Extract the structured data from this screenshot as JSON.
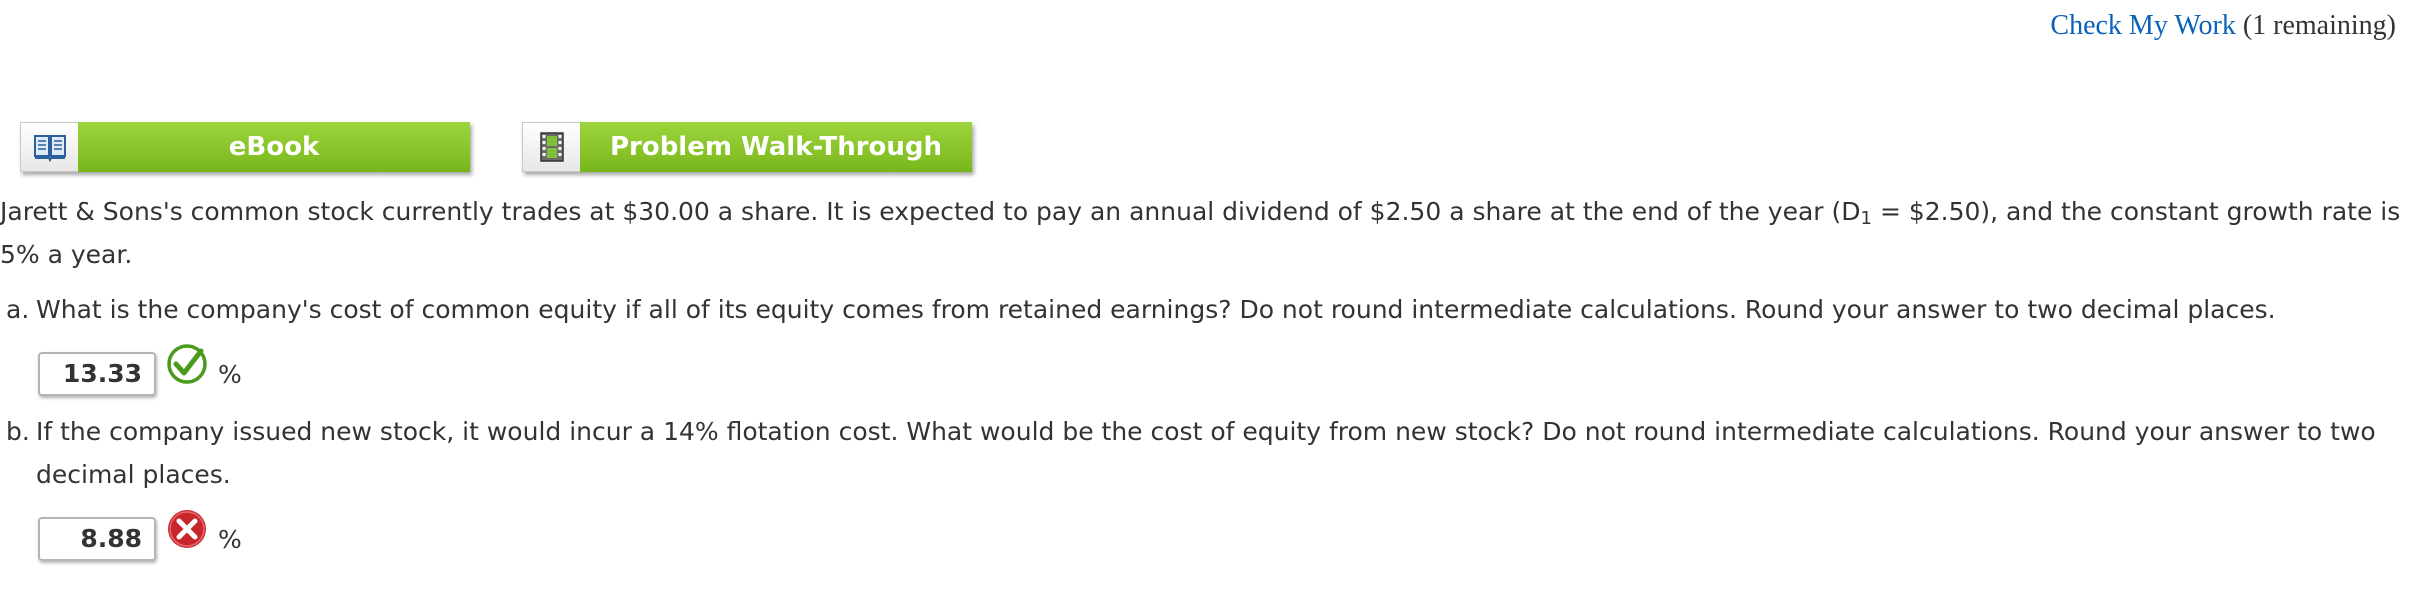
{
  "header": {
    "check_link": "Check My Work",
    "remaining": "(1 remaining)"
  },
  "resources": {
    "ebook": {
      "label": "eBook",
      "icon": "book-icon"
    },
    "walkthrough": {
      "label": "Problem Walk-Through",
      "icon": "film-icon"
    }
  },
  "problem": {
    "intro_part1": "Jarett & Sons's common stock currently trades at $30.00 a share. It is expected to pay an annual dividend of $2.50 a share at the end of the year (D",
    "intro_sub": "1",
    "intro_part2": " = $2.50), and the constant growth rate is 5% a year."
  },
  "questions": [
    {
      "letter": "a.",
      "text": "What is the company's cost of common equity if all of its equity comes from retained earnings? Do not round intermediate calculations. Round your answer to two decimal places.",
      "answer": "13.33",
      "unit": "%",
      "status": "correct",
      "status_icon": "checkmark-icon"
    },
    {
      "letter": "b.",
      "text": "If the company issued new stock, it would incur a 14% flotation cost. What would be the cost of equity from new stock? Do not round intermediate calculations. Round your answer to two decimal places.",
      "answer": "8.88",
      "unit": "%",
      "status": "incorrect",
      "status_icon": "x-icon"
    }
  ],
  "colors": {
    "link": "#0a63b8",
    "button_green": "#86c22a",
    "correct": "#4a9a1c",
    "incorrect": "#c8262b"
  }
}
